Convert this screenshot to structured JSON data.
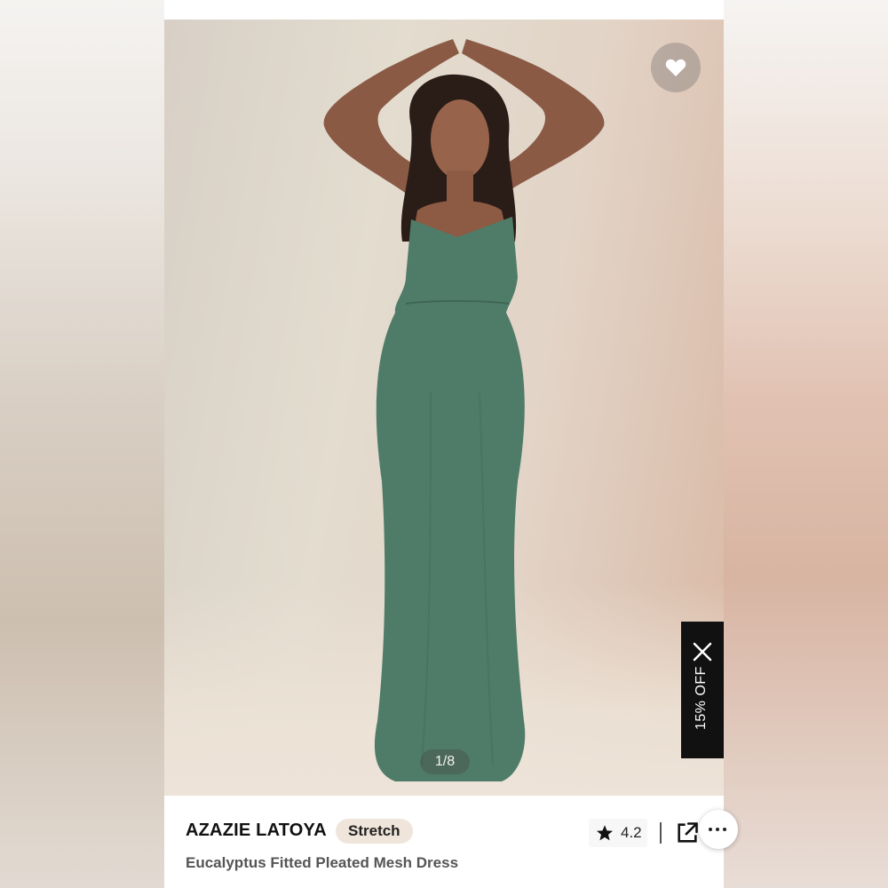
{
  "product": {
    "brand": "AZAZIE LATOYA",
    "tag": "Stretch",
    "subtitle": "Eucalyptus Fitted Pleated Mesh Dress",
    "rating": "4.2"
  },
  "gallery": {
    "counter": "1/8"
  },
  "promo": {
    "label": "15% OFF"
  },
  "icons": {
    "favorite": "heart-icon",
    "close": "close-icon",
    "rating": "star-icon",
    "share": "share-external-icon",
    "more": "more-options-icon"
  },
  "colors": {
    "dress": "#4f7c68",
    "promo_bg": "#111111",
    "tag_bg": "#efe5da"
  }
}
